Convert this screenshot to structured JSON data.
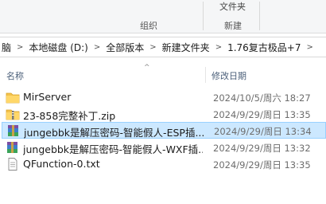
{
  "ribbon": {
    "group_organize": "组织",
    "group_new": "新建",
    "top_cut_label": "文件夹"
  },
  "address": {
    "crumbs": [
      "脑",
      "本地磁盘 (D:)",
      "全部版本",
      "新建文件夹",
      "1.76复古极品+7"
    ]
  },
  "columns": {
    "name": "名称",
    "modified": "修改日期"
  },
  "files": [
    {
      "name": "MirServer",
      "modified": "2024/10/5/周六 18:27",
      "type": "folder"
    },
    {
      "name": "23-858完整补丁.zip",
      "modified": "2024/9/29/周日 13:35",
      "type": "zip"
    },
    {
      "name": "jungebbk是解压密码-智能假人-ESP插...",
      "modified": "2024/9/29/周日 13:34",
      "type": "archive",
      "selected": true
    },
    {
      "name": "jungebbk是解压密码-智能假人-WXF插...",
      "modified": "2024/9/29/周日 13:32",
      "type": "archive"
    },
    {
      "name": "QFunction-0.txt",
      "modified": "2024/9/29/周日 13:35",
      "type": "text"
    }
  ],
  "colors": {
    "selection_bg": "#cce8ff",
    "selection_border": "#99d1ff",
    "folder": "#f3c24c",
    "header_text": "#4c607a"
  },
  "icons": {
    "folder": "folder-icon",
    "zip": "zip-folder-icon",
    "archive": "winrar-archive-icon",
    "text": "text-file-icon"
  }
}
